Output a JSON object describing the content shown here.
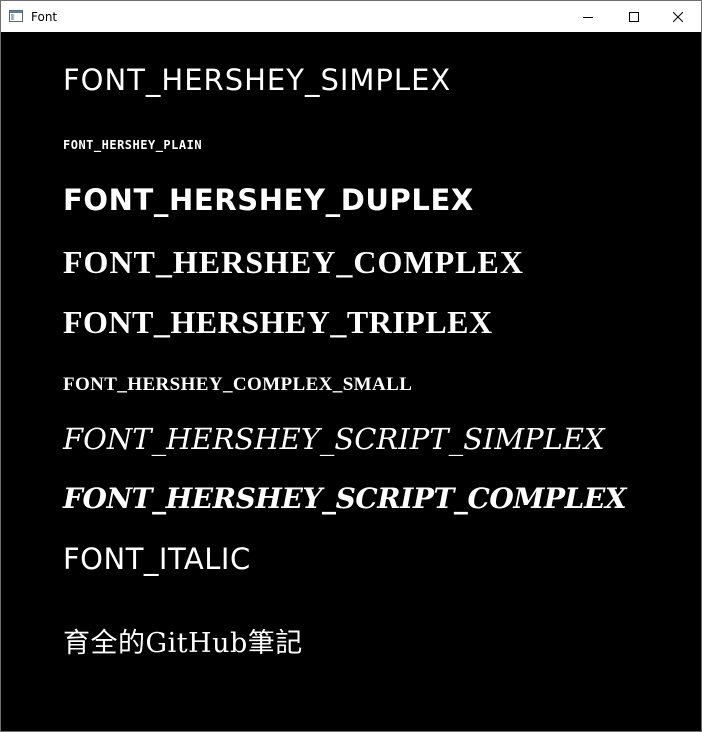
{
  "window": {
    "title": "Font",
    "controls": {
      "minimize": "minimize-icon",
      "maximize": "maximize-icon",
      "close": "close-icon"
    }
  },
  "canvas": {
    "background": "#000000",
    "text_color": "#ffffff",
    "lines": [
      "FONT_HERSHEY_SIMPLEX",
      "FONT_HERSHEY_PLAIN",
      "FONT_HERSHEY_DUPLEX",
      "FONT_HERSHEY_COMPLEX",
      "FONT_HERSHEY_TRIPLEX",
      "FONT_HERSHEY_COMPLEX_SMALL",
      "FONT_HERSHEY_SCRIPT_SIMPLEX",
      "FONT_HERSHEY_SCRIPT_COMPLEX",
      "FONT_ITALIC",
      "育全的GitHub筆記"
    ]
  }
}
